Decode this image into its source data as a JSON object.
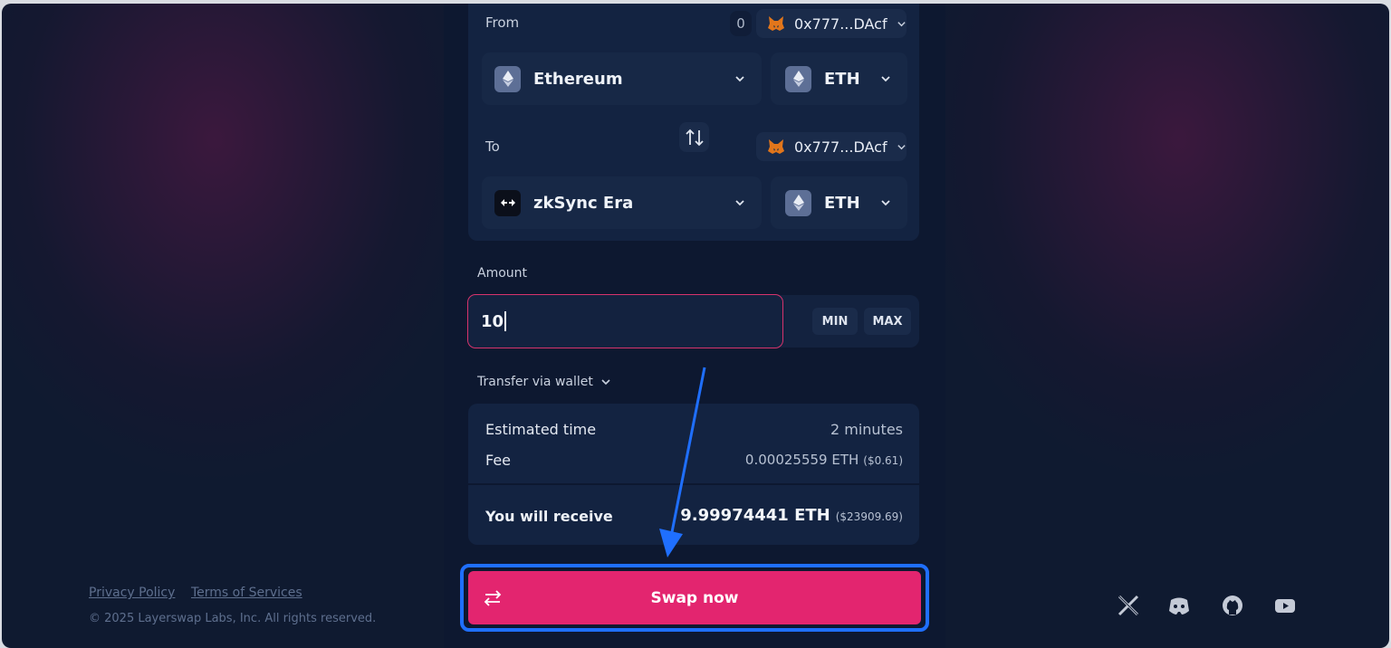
{
  "from": {
    "label": "From",
    "balance": "0",
    "wallet": "0x777...DAcf",
    "network": "Ethereum",
    "token": "ETH"
  },
  "to": {
    "label": "To",
    "wallet": "0x777...DAcf",
    "network": "zkSync Era",
    "token": "ETH"
  },
  "amount": {
    "label": "Amount",
    "value": "10",
    "min_label": "MIN",
    "max_label": "MAX"
  },
  "transfer_via": "Transfer via wallet",
  "summary": {
    "estimated_time_label": "Estimated time",
    "estimated_time_value": "2 minutes",
    "fee_label": "Fee",
    "fee_value": "0.00025559 ETH",
    "fee_usd": "($0.61)",
    "receive_label": "You will receive",
    "receive_value": "9.99974441 ETH",
    "receive_usd": "($23909.69)"
  },
  "swap_button": "Swap now",
  "footer": {
    "privacy": "Privacy Policy",
    "terms": "Terms of Services",
    "copyright": "© 2025 Layerswap Labs, Inc. All rights reserved."
  },
  "colors": {
    "accent": "#e3256f",
    "highlight": "#1f6fff",
    "background": "#0f1a30"
  }
}
